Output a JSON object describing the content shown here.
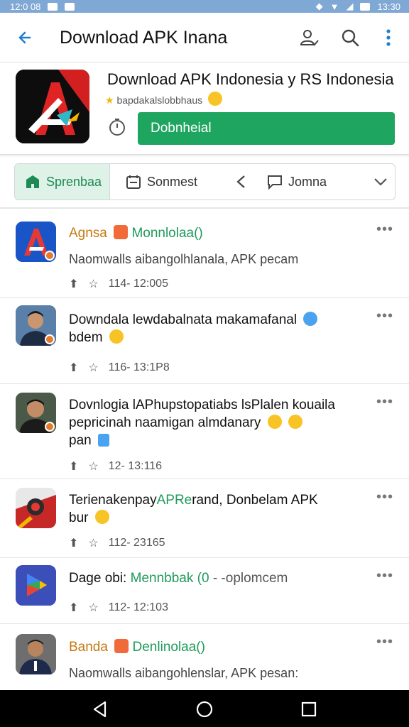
{
  "status_bar": {
    "time_left": "12:0 08",
    "time_right": "13:30"
  },
  "app_bar": {
    "title": "Download APK Inana",
    "icons": [
      "back-arrow-icon",
      "user-check-icon",
      "search-icon",
      "more-vert-icon"
    ]
  },
  "app_card": {
    "title": "Download APK Indonesia y RS Indonesia",
    "subtitle": "bapdakalslobbhaus",
    "button_label": "Dobnheial",
    "icons": [
      "app-logo",
      "timer-icon",
      "star-icon"
    ]
  },
  "tabs": [
    {
      "label": "Sprenbaa",
      "icon": "store-icon",
      "active": true
    },
    {
      "label": "Sonmest",
      "icon": "calendar-icon",
      "active": false
    },
    {
      "label": "",
      "icon": "chevron-left-icon",
      "active": false
    },
    {
      "label": "Jomna",
      "icon": "chat-icon",
      "active": false
    },
    {
      "label": "",
      "icon": "chevron-down-icon",
      "active": false
    }
  ],
  "feed": [
    {
      "name_a": "Agnsa",
      "name_b": "Monnlolaa()",
      "desc": "Naomwalls aibangolhlanala, APK pecam",
      "time": "114- 12:005",
      "avatar": "app-logo-a"
    },
    {
      "line1": "Downdala lewdabalnata makamafanal",
      "line2": "bdem",
      "time": "116- 13:1P8",
      "avatar": "person-1"
    },
    {
      "line1": "Dovnlogia lAPhupstopatiabs lsPlalen kouaila",
      "line2": "pepricinah naamigan almdanary",
      "line3": "pan",
      "time": "12- 13:116",
      "avatar": "person-2"
    },
    {
      "line1_a": "Terienakenpay",
      "line1_green": "APRe",
      "line1_b": "rand, Donbelam APK",
      "line2": "bur",
      "time": "112- 23165",
      "avatar": "app-logo-red"
    },
    {
      "line1_a": "Dage obi:",
      "line1_green": "Mennbbak (0",
      "line1_b": "- -oplomcem",
      "time": "112- 12:103",
      "avatar": "play-logo"
    },
    {
      "name_a": "Banda",
      "name_b": "Denlinolaa()",
      "desc": "Naomwalls aibangohlenslar, APK pesan:",
      "avatar": "person-3"
    }
  ],
  "more_label": "•••",
  "colors": {
    "accent": "#1ea55f",
    "status_bar": "#7fa8d4",
    "link_blue": "#1f7fd1"
  }
}
